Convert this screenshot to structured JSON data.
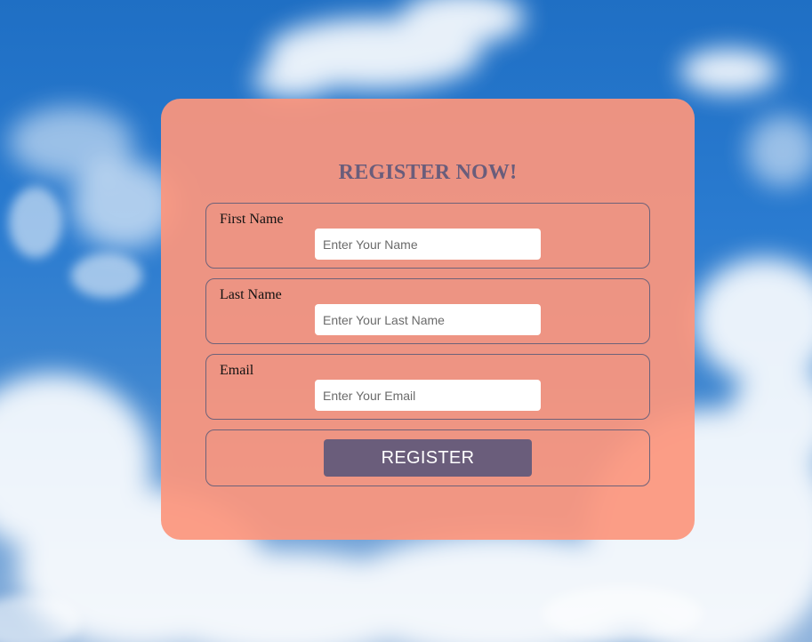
{
  "form": {
    "title": "REGISTER NOW!",
    "fields": [
      {
        "label": "First Name",
        "placeholder": "Enter Your Name",
        "value": ""
      },
      {
        "label": "Last Name",
        "placeholder": "Enter Your Last Name",
        "value": ""
      },
      {
        "label": "Email",
        "placeholder": "Enter Your Email",
        "value": ""
      }
    ],
    "submit_label": "REGISTER"
  },
  "colors": {
    "card_background": "#fc967d",
    "accent": "#6a5d7b",
    "sky": "#1f6fc4"
  }
}
